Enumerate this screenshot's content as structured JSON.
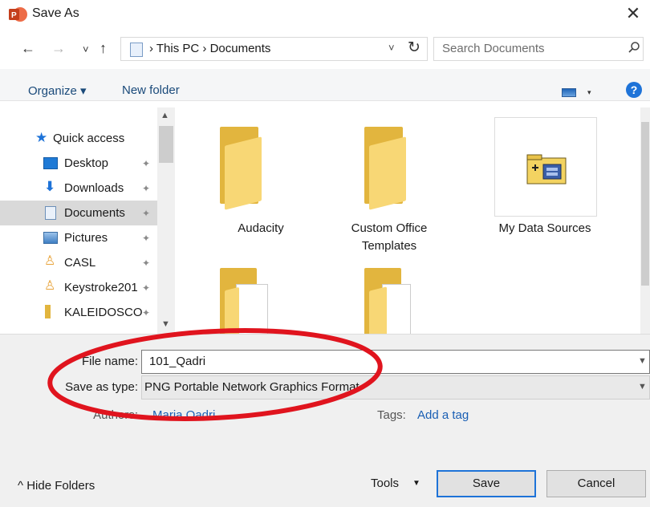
{
  "window": {
    "title": "Save As",
    "close_glyph": "✕"
  },
  "nav": {
    "back": "←",
    "forward": "→",
    "recent": "˅",
    "up": "↑"
  },
  "address": {
    "crumbs": "›  This PC  ›  Documents",
    "dropdown": "˅",
    "refresh": "↻"
  },
  "search": {
    "placeholder": "Search Documents",
    "icon": "search-icon"
  },
  "toolbar": {
    "organize": "Organize ▾",
    "new_folder": "New folder",
    "view_caret": "▾",
    "help": "?"
  },
  "sidebar": {
    "items": [
      {
        "label": "Quick access",
        "icon": "star-icon",
        "pinned": false,
        "selected": false
      },
      {
        "label": "Desktop",
        "icon": "desktop-icon",
        "pinned": true,
        "selected": false
      },
      {
        "label": "Downloads",
        "icon": "download-icon",
        "pinned": true,
        "selected": false
      },
      {
        "label": "Documents",
        "icon": "documents-icon",
        "pinned": true,
        "selected": true
      },
      {
        "label": "Pictures",
        "icon": "pictures-icon",
        "pinned": true,
        "selected": false
      },
      {
        "label": "CASL",
        "icon": "user-folder-icon",
        "pinned": true,
        "selected": false
      },
      {
        "label": "Keystroke201",
        "icon": "user-folder-icon",
        "pinned": true,
        "selected": false
      },
      {
        "label": "KALEIDOSCO",
        "icon": "folder-icon",
        "pinned": true,
        "selected": false
      }
    ],
    "pin_glyph": "📌"
  },
  "files": [
    {
      "name": "Audacity"
    },
    {
      "name": "Custom Office Templates"
    },
    {
      "name": "My Data Sources"
    }
  ],
  "form": {
    "file_name_label": "File name:",
    "file_name_value": "101_Qadri",
    "save_type_label": "Save as type:",
    "save_type_value": "PNG Portable Network Graphics Format",
    "authors_label": "Authors:",
    "authors_value": "Maria Qadri",
    "tags_label": "Tags:",
    "tags_value": "Add a tag"
  },
  "footer": {
    "hide_folders": "^  Hide Folders",
    "tools": "Tools",
    "tools_caret": "▼",
    "save": "Save",
    "cancel": "Cancel"
  },
  "colors": {
    "accent": "#1e73d8",
    "folder": "#f8d775",
    "annotation": "#e0141e"
  }
}
